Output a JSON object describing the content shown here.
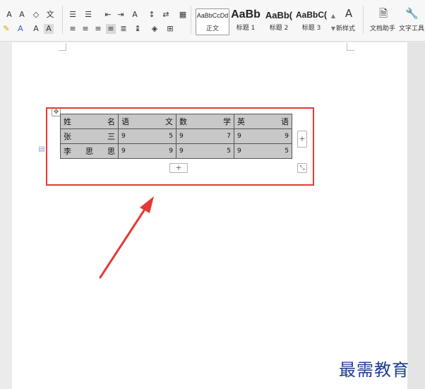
{
  "ribbon": {
    "font_tools": [
      "A+",
      "A-",
      "clear-format",
      "pinyin"
    ],
    "styles": [
      {
        "sample": "AaBbCcDd",
        "name": "正文"
      },
      {
        "sample": "AaBb",
        "name": "标题 1"
      },
      {
        "sample": "AaBb(",
        "name": "标题 2"
      },
      {
        "sample": "AaBbC(",
        "name": "标题 3"
      }
    ],
    "new_style_label": "新样式",
    "doc_assistant_label": "文档助手",
    "text_tools_label": "文字工具"
  },
  "table": {
    "rows": [
      [
        "姓名",
        "语文",
        "数学",
        "英语"
      ],
      [
        "张三",
        "9 5",
        "9 7",
        "9 9"
      ],
      [
        "李思思",
        "9 9",
        "9 5",
        "9 5"
      ]
    ]
  },
  "controls": {
    "add_column": "+",
    "add_row": "+"
  },
  "watermark": "最需教育",
  "colors": {
    "highlight": "#e53935",
    "cell_shading": "#c8c8c8",
    "watermark": "#1c3d8c"
  }
}
